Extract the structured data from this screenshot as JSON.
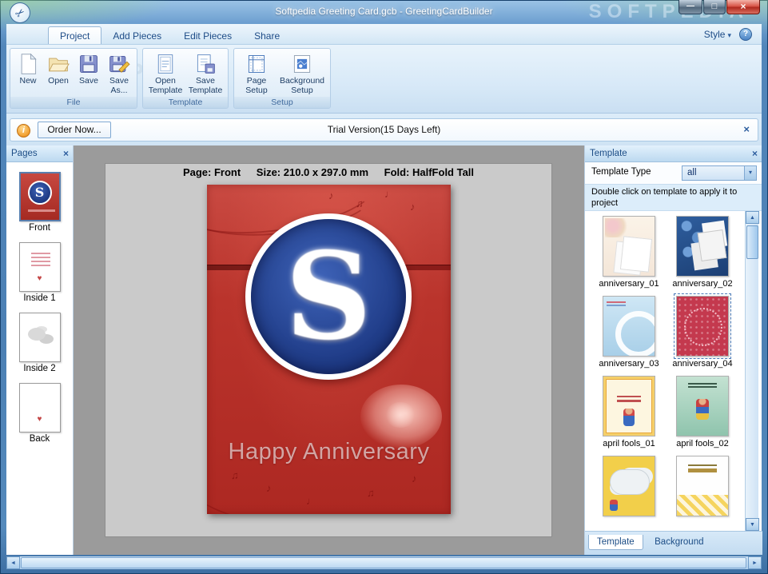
{
  "window": {
    "title": "Softpedia Greeting Card.gcb - GreetingCardBuilder",
    "watermark": "SOFTPEDIA"
  },
  "icons": {
    "app_logo": "✂",
    "minimize": "—",
    "maximize": "□",
    "close": "×",
    "help": "?",
    "info": "i",
    "caret_down": "▾",
    "arrow_up": "▲",
    "arrow_down": "▼",
    "arrow_left": "◄",
    "arrow_right": "►",
    "heart": "♥",
    "note_eighth": "♪",
    "note_beamed": "♫",
    "note_quarter": "♩"
  },
  "ribbon": {
    "tabs": [
      {
        "label": "Project",
        "active": true
      },
      {
        "label": "Add Pieces",
        "active": false
      },
      {
        "label": "Edit Pieces",
        "active": false
      },
      {
        "label": "Share",
        "active": false
      }
    ],
    "style_menu": "Style",
    "groups": {
      "file": {
        "label": "File",
        "buttons": [
          {
            "label": "New"
          },
          {
            "label": "Open"
          },
          {
            "label": "Save"
          },
          {
            "label": "Save As..."
          }
        ]
      },
      "template": {
        "label": "Template",
        "buttons": [
          {
            "label": "Open Template"
          },
          {
            "label": "Save Template"
          }
        ]
      },
      "setup": {
        "label": "Setup",
        "buttons": [
          {
            "label": "Page Setup"
          },
          {
            "label": "Background Setup"
          }
        ]
      }
    }
  },
  "trial_bar": {
    "order_button": "Order Now...",
    "message": "Trial Version(15 Days Left)"
  },
  "pages_panel": {
    "title": "Pages",
    "pages": [
      {
        "label": "Front",
        "selected": true
      },
      {
        "label": "Inside 1",
        "selected": false
      },
      {
        "label": "Inside 2",
        "selected": false
      },
      {
        "label": "Back",
        "selected": false
      }
    ]
  },
  "canvas": {
    "page_label": "Page: Front",
    "size_label": "Size: 210.0 x 297.0 mm",
    "fold_label": "Fold: HalfFold Tall",
    "card": {
      "logo_letter": "S",
      "caption": "Happy Anniversary"
    }
  },
  "template_panel": {
    "title": "Template",
    "type_label": "Template Type",
    "type_value": "all",
    "hint": "Double click on template to apply it to project",
    "templates": [
      {
        "label": "anniversary_01",
        "selected": false
      },
      {
        "label": "anniversary_02",
        "selected": false
      },
      {
        "label": "anniversary_03",
        "selected": false
      },
      {
        "label": "anniversary_04",
        "selected": true
      },
      {
        "label": "april fools_01",
        "selected": false
      },
      {
        "label": "april fools_02",
        "selected": false
      },
      {
        "label": "",
        "selected": false
      },
      {
        "label": "",
        "selected": false
      }
    ],
    "tabs": [
      {
        "label": "Template",
        "active": true
      },
      {
        "label": "Background",
        "active": false
      }
    ]
  }
}
